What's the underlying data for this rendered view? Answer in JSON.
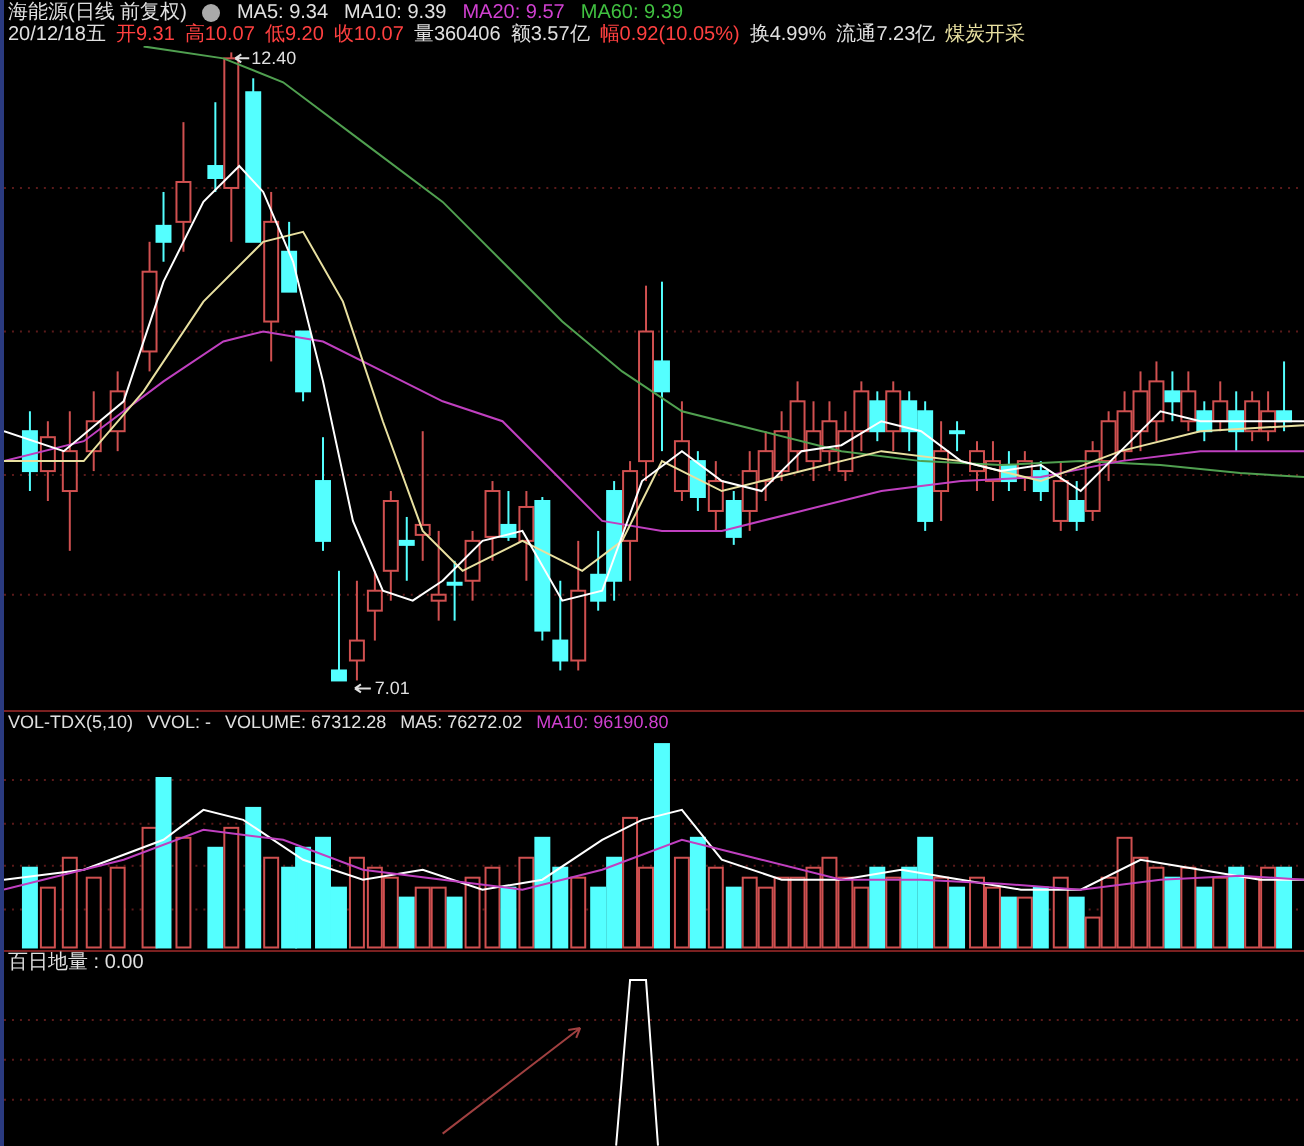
{
  "header": {
    "title": "海能源(日线 前复权)",
    "moving_averages": [
      {
        "label": "MA5: 9.34",
        "color": "#e0e0e0"
      },
      {
        "label": "MA10: 9.39",
        "color": "#e0e0e0"
      },
      {
        "label": "MA20: 9.57",
        "color": "#d040d0"
      },
      {
        "label": "MA60: 9.39",
        "color": "#40c040"
      }
    ]
  },
  "quote": [
    {
      "text": "20/12/18五",
      "color": "#e0e0e0"
    },
    {
      "text": "开9.31",
      "color": "#ff4040"
    },
    {
      "text": "高10.07",
      "color": "#ff4040"
    },
    {
      "text": "低9.20",
      "color": "#ff4040"
    },
    {
      "text": "收10.07",
      "color": "#ff4040"
    },
    {
      "text": "量360406",
      "color": "#e0e0e0"
    },
    {
      "text": "额3.57亿",
      "color": "#e0e0e0"
    },
    {
      "text": "幅0.92(10.05%)",
      "color": "#ff4040"
    },
    {
      "text": "换4.99%",
      "color": "#e0e0e0"
    },
    {
      "text": "流通7.23亿",
      "color": "#e0e0e0"
    },
    {
      "text": "煤炭开采",
      "color": "#e8e0a0"
    }
  ],
  "price_chart": {
    "high_label": "12.40",
    "low_label": "7.01"
  },
  "volume_panel": {
    "items": [
      {
        "text": "VOL-TDX(5,10)",
        "color": "#e0e0e0"
      },
      {
        "text": "VVOL: -",
        "color": "#e0e0e0"
      },
      {
        "text": "VOLUME: 67312.28",
        "color": "#e0e0e0"
      },
      {
        "text": "MA5: 76272.02",
        "color": "#e0e0e0"
      },
      {
        "text": "MA10: 96190.80",
        "color": "#d040d0"
      }
    ]
  },
  "indicator_panel": {
    "label": "百日地量 : 0.00"
  }
}
